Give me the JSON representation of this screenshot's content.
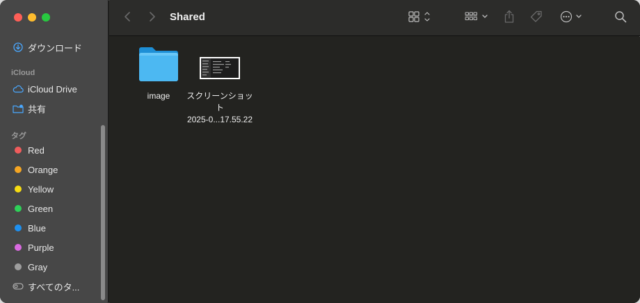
{
  "window": {
    "title": "Shared"
  },
  "sidebar": {
    "favorites": [
      {
        "label": "ダウンロード",
        "icon": "download-icon"
      }
    ],
    "icloud_header": "iCloud",
    "icloud": [
      {
        "label": "iCloud Drive",
        "icon": "cloud-icon"
      },
      {
        "label": "共有",
        "icon": "shared-folder-icon"
      }
    ],
    "tags_header": "タグ",
    "tags": [
      {
        "label": "Red",
        "color": "#f05c5c"
      },
      {
        "label": "Orange",
        "color": "#f5a623"
      },
      {
        "label": "Yellow",
        "color": "#f7dc12"
      },
      {
        "label": "Green",
        "color": "#2ed158"
      },
      {
        "label": "Blue",
        "color": "#1e90f0"
      },
      {
        "label": "Purple",
        "color": "#d96ae0"
      },
      {
        "label": "Gray",
        "color": "#9e9e9e"
      }
    ],
    "all_tags": {
      "label": "すべてのタ...",
      "icon": "tag-outline-icon"
    }
  },
  "toolbar": {
    "back_icon": "chevron-left-icon",
    "forward_icon": "chevron-right-icon",
    "view_icon": "icon-grid-icon",
    "group_icon": "group-icon",
    "share_icon": "share-icon",
    "tag_icon": "tag-icon",
    "more_icon": "ellipsis-circle-icon",
    "search_icon": "search-icon"
  },
  "files": [
    {
      "name": "image",
      "type": "folder"
    },
    {
      "name_line1": "スクリーンショット",
      "name_line2": "2025-0...17.55.22",
      "type": "screenshot"
    }
  ]
}
